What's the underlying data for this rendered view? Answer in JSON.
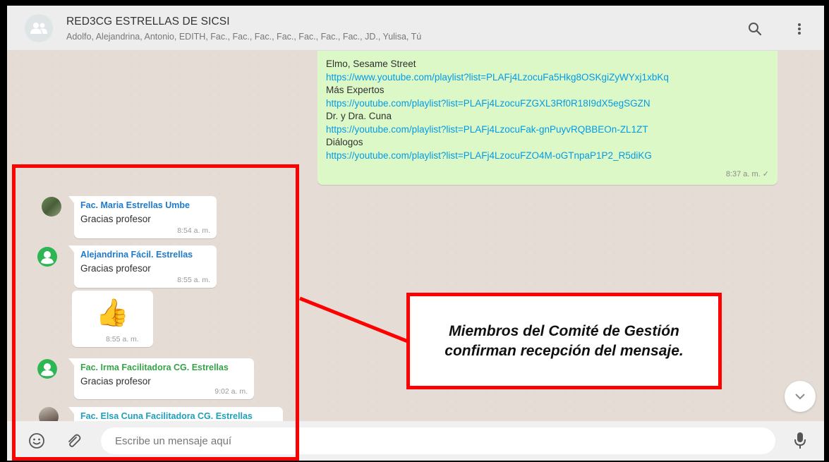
{
  "header": {
    "group_title": "RED3CG ESTRELLAS DE SICSI",
    "members": "Adolfo, Alejandrina, Antonio, EDITH, Fac., Fac., Fac., Fac., Fac., Fac., Fac., JD., Yulisa, Tú",
    "icons": [
      "group-avatar-icon",
      "search-icon",
      "menu-icon"
    ]
  },
  "outgoing_message": {
    "lines": [
      {
        "kind": "text",
        "value": "Elmo, Sesame Street"
      },
      {
        "kind": "link",
        "value": "https://www.youtube.com/playlist?list=PLAFj4LzocuFa5Hkg8OSKgiZyWYxj1xbKq"
      },
      {
        "kind": "text",
        "value": "Más Expertos"
      },
      {
        "kind": "link",
        "value": "https://youtube.com/playlist?list=PLAFj4LzocuFZGXL3Rf0R18I9dX5egSGZN"
      },
      {
        "kind": "text",
        "value": "Dr. y Dra. Cuna"
      },
      {
        "kind": "link",
        "value": "https://youtube.com/playlist?list=PLAFj4LzocuFak-gnPuyvRQBBEOn-ZL1ZT"
      },
      {
        "kind": "text",
        "value": "Diálogos"
      },
      {
        "kind": "link",
        "value": "https://youtube.com/playlist?list=PLAFj4LzocuFZO4M-oGTnpaP1P2_R5diKG"
      }
    ],
    "time": "8:37 a. m. ✓"
  },
  "incoming": [
    {
      "sender": "Fac. Maria Estrellas Umbe",
      "sender_color": "#1f7aca",
      "text": "Gracias profesor",
      "time": "8:54 a. m."
    },
    {
      "sender": "Alejandrina Fácil. Estrellas",
      "sender_color": "#1f7aca",
      "text": "Gracias profesor",
      "time": "8:55 a. m."
    },
    {
      "sticker": "👍",
      "time": "8:55 a. m."
    },
    {
      "sender": "Fac. Irma Facilitadora CG. Estrellas",
      "sender_color": "#35a347",
      "text": "Gracias profesor",
      "time": "9:02 a. m."
    },
    {
      "sender": "Fac. Elsa Cuna Facilitadora CG. Estrellas",
      "sender_color": "#1f9fb9"
    }
  ],
  "footer": {
    "placeholder": "Escribe un mensaje aquí",
    "icons": [
      "emoji-icon",
      "attach-icon",
      "microphone-icon"
    ]
  },
  "annotation": {
    "callout_text": "Miembros del Comité de Gestión confirman recepción del mensaje.",
    "highlight_color": "#ff0000"
  },
  "colors": {
    "chat_bg": "#e5ddd5",
    "outgoing_bubble": "#dcf8c6",
    "link": "#039be5"
  }
}
